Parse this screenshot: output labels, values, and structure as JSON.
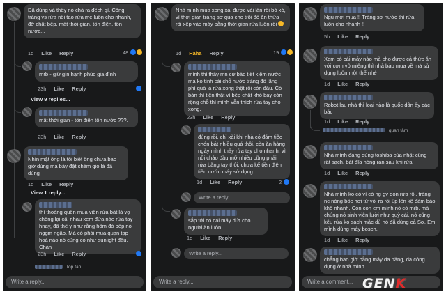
{
  "common": {
    "like": "Like",
    "reply": "Reply",
    "write_reply": "Write a reply...",
    "write_comment": "Write a comment..."
  },
  "panel1": {
    "c1": {
      "text": "Đã dùng và thấy nó chả ra đếch gì. Công tráng vs rửa nồi tao rửa mẹ luôn cho nhanh, đỡ chật bếp, mất thời gian, tốn điện, tốn nước...",
      "time": "1d",
      "reacts": "48"
    },
    "r1": {
      "text": "mrb - giữ gìn hạnh phúc gia đình",
      "time": "23h"
    },
    "view9": "View 9 replies...",
    "r2": {
      "text": "mất thời gian - tốn điện tốn nước ???.",
      "time": "23h"
    },
    "c2": {
      "text": "Nhìn mặt ông là tôi biết ông chưa bao giờ dùng mà bày đặt chém gió là đã dùng",
      "time": "1d"
    },
    "view1": "View 1 reply...",
    "c3": {
      "text": "thì thoảng quên mua viên rửa bát là vợ chồng lại cãi nhau xem đứa nào rửa tay hnay, đã thế y như rằng hôm đó bếp nó nggm ngập. Mà có phải mua quạn tạp hoá nào nó cũng có như sunlight đâu. Chán",
      "time": "23h"
    },
    "topfan": "Top fan"
  },
  "panel2": {
    "c1": {
      "text": "Nhà mình mua xong xài được vài lần rồi bỏ xó, vì thời gian tráng sơ qua cho trôi đồ ăn thừa rồi xếp vào máy bằng thời gian rửa luôn rồi",
      "time": "1d",
      "haha": "Haha",
      "reacts": "19"
    },
    "r1": {
      "text": "mình thì thấy mn cứ bảo tiết kiệm nước mà ko tính cái chỗ nước tráng đồ lãng phí quá là rửa xong thật rồi còn đâu. Có bản thì tiện thật vì bếp chật khó bày còn rộng chỗ thì mình vẫn thích rửa tay cho xong.",
      "time": "23h"
    },
    "r2": {
      "text": "đúng rồi, chỉ xài khi nhà có đám tiệc chén bát nhiều quá thôi, còn ăn hàng ngày mình thấy rửa tay cho nhanh, vì nồi chảo đầu mỡ nhiều cũng phải rửa bằng tay thôi, chưa kể tiền điện tiền nước máy sử dụng",
      "time": "1d",
      "reacts": "2"
    },
    "r3": {
      "text": "sắp tới có cái máy đứt cho người ăn luôn",
      "time": "1d"
    }
  },
  "panel3": {
    "c1": {
      "text": "Ngu mới mua !! Tráng sơ nước thì rửa luôn cho nhanh !!",
      "time": "5h"
    },
    "c2": {
      "text": "Xem có cái máy nào mà cho được cả thức ăn với cơm vô miệng thì nhà bảo mua về mà sử dụng luôn một thể nhé",
      "time": "1d"
    },
    "c3": {
      "text": "Robot lau nhà thì loại nào là quốc dân ấy các bác",
      "time": "1d",
      "quan_tam": "quan tâm"
    },
    "c4": {
      "text": "Nhà mình đang dùng toshiba của nhật cũng rất sạch, bát đĩa nóng ran sau khi rửa",
      "time": "1d"
    },
    "c5": {
      "text": "Nhà mình ko có vì có ng gv dọn rửa rồi, tráng nc nóng bốc hơi từ vòi ra rồi úp lên kệ đảm bảo khô nhanh. Còn con em mình nó có mrb, mà chúng nó sinh viên lười như quỷ cái, nó cũng kêu rửa ko sạch mặc dù nó đã dùng cả Sơ. Em mình dùng máy bosch.",
      "time": "1d"
    },
    "c6": {
      "text": "chẳng bao giờ bằng máy đa năng, đa công dụng ở nhà mình.",
      "time": "1d"
    }
  },
  "brand": {
    "part1": "GEN",
    "part2": "K",
    "accent": "#e02b2b"
  },
  "colors": {
    "panel_bg": "#18191a",
    "bubble_bg": "#3a3b3c",
    "text": "#e4e6eb",
    "muted": "#b0b3b8",
    "like_blue": "#2078f4",
    "haha_yellow": "#f7b928"
  }
}
